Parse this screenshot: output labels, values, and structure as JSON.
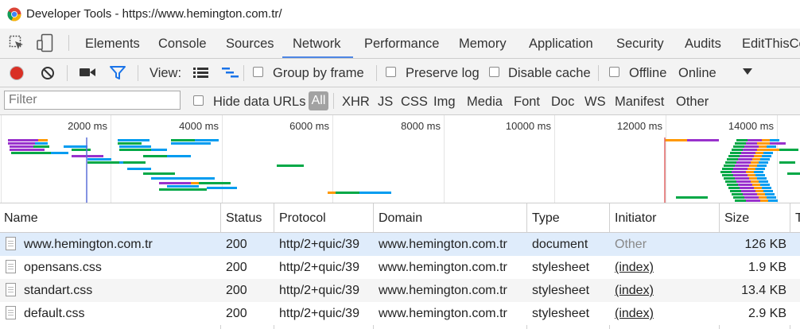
{
  "window": {
    "title": "Developer Tools - https://www.hemington.com.tr/"
  },
  "tabs": [
    "Elements",
    "Console",
    "Sources",
    "Network",
    "Performance",
    "Memory",
    "Application",
    "Security",
    "Audits",
    "EditThisCo"
  ],
  "active_tab": "Network",
  "toolbar": {
    "view_label": "View:",
    "group_by_frame": "Group by frame",
    "preserve_log": "Preserve log",
    "disable_cache": "Disable cache",
    "offline": "Offline",
    "throttle": "Online"
  },
  "filterbar": {
    "placeholder": "Filter",
    "hide_data_urls": "Hide data URLs",
    "types": [
      "All",
      "XHR",
      "JS",
      "CSS",
      "Img",
      "Media",
      "Font",
      "Doc",
      "WS",
      "Manifest",
      "Other"
    ]
  },
  "overview": {
    "ticks": [
      "2000 ms",
      "4000 ms",
      "6000 ms",
      "8000 ms",
      "10000 ms",
      "12000 ms",
      "14000 ms"
    ]
  },
  "columns": [
    "Name",
    "Status",
    "Protocol",
    "Domain",
    "Type",
    "Initiator",
    "Size",
    "T"
  ],
  "rows": [
    {
      "name": "www.hemington.com.tr",
      "status": "200",
      "protocol": "http/2+quic/39",
      "domain": "www.hemington.com.tr",
      "type": "document",
      "initiator": "Other",
      "size": "126 KB"
    },
    {
      "name": "opensans.css",
      "status": "200",
      "protocol": "http/2+quic/39",
      "domain": "www.hemington.com.tr",
      "type": "stylesheet",
      "initiator": "(index)",
      "size": "1.9 KB"
    },
    {
      "name": "standart.css",
      "status": "200",
      "protocol": "http/2+quic/39",
      "domain": "www.hemington.com.tr",
      "type": "stylesheet",
      "initiator": "(index)",
      "size": "13.4 KB"
    },
    {
      "name": "default.css",
      "status": "200",
      "protocol": "http/2+quic/39",
      "domain": "www.hemington.com.tr",
      "type": "stylesheet",
      "initiator": "(index)",
      "size": "2.9 KB"
    }
  ],
  "colors": {
    "accent": "#4e86e3",
    "record": "#d93025",
    "filter_icon": "#1a73e8",
    "selected_row": "#dfecfb",
    "waterfall_waiting": "#00a846",
    "waterfall_download": "#009cf0",
    "waterfall_stalled": "#9932cc",
    "waterfall_ssl": "#ff9800"
  },
  "icons": [
    "chrome-logo-icon",
    "inspect-element-icon",
    "device-toolbar-icon",
    "record-icon",
    "clear-icon",
    "screenshot-camera-icon",
    "filter-icon",
    "large-rows-icon",
    "waterfall-icon",
    "dropdown-arrow-icon",
    "document-file-icon"
  ]
}
